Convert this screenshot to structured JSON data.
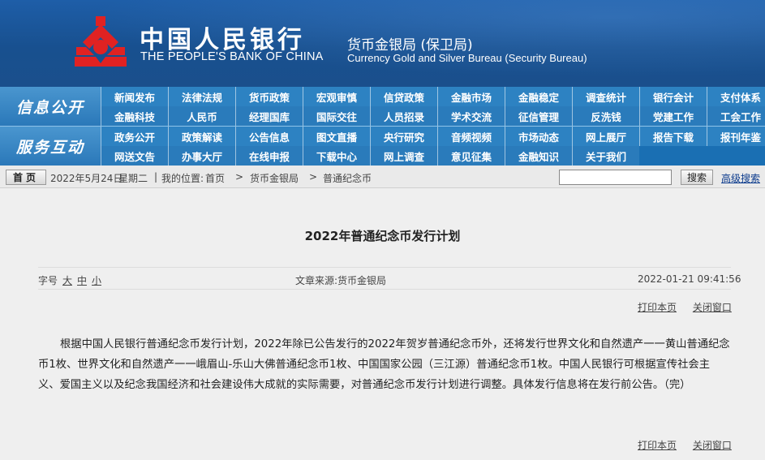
{
  "header": {
    "bank_name_cn": "中国人民银行",
    "bank_name_en": "THE PEOPLE'S BANK OF CHINA",
    "bureau_cn": "货币金银局 (保卫局)",
    "bureau_en": "Currency  Gold and Silver Bureau (Security Bureau)",
    "logo_color": "#e02222",
    "background": "#1b5497"
  },
  "nav": {
    "section1": "信息公开",
    "section2": "服务互动",
    "row1": [
      "新闻发布",
      "法律法规",
      "货币政策",
      "宏观审慎",
      "信贷政策",
      "金融市场",
      "金融稳定",
      "调查统计",
      "银行会计",
      "支付体系",
      "金融科技",
      "人民币",
      "经理国库",
      "国际交往",
      "人员招录",
      "学术交流",
      "征信管理",
      "反洗钱",
      "党建工作",
      "工会工作"
    ],
    "row2": [
      "政务公开",
      "政策解读",
      "公告信息",
      "图文直播",
      "央行研究",
      "音频视频",
      "市场动态",
      "网上展厅",
      "报告下载",
      "报刊年鉴",
      "网送文告",
      "办事大厅",
      "在线申报",
      "下载中心",
      "网上调查",
      "意见征集",
      "金融知识",
      "关于我们"
    ]
  },
  "toolbar": {
    "home_label": "首页",
    "date": "2022年5月24日",
    "weekday": "星期二",
    "location_label": "我的位置:",
    "crumb_home": "首页",
    "crumb_bureau": "货币金银局",
    "crumb_current": "普通纪念币",
    "search_button": "搜索",
    "advanced_search": "高级搜索"
  },
  "article": {
    "title": "2022年普通纪念币发行计划",
    "font_label": "字号",
    "font_large": "大",
    "font_medium": "中",
    "font_small": "小",
    "source": "文章来源:货币金银局",
    "datetime": "2022-01-21 09:41:56",
    "print": "打印本页",
    "close": "关闭窗口",
    "body": "根据中国人民银行普通纪念币发行计划，2022年除已公告发行的2022年贺岁普通纪念币外，还将发行世界文化和自然遗产一一黄山普通纪念币1枚、世界文化和自然遗产一一峨眉山-乐山大佛普通纪念币1枚、中国国家公园（三江源）普通纪念币1枚。中国人民银行可根据宣传社会主义、爱国主义以及纪念我国经济和社会建设伟大成就的实际需要，对普通纪念币发行计划进行调整。具体发行信息将在发行前公告。（完）"
  }
}
